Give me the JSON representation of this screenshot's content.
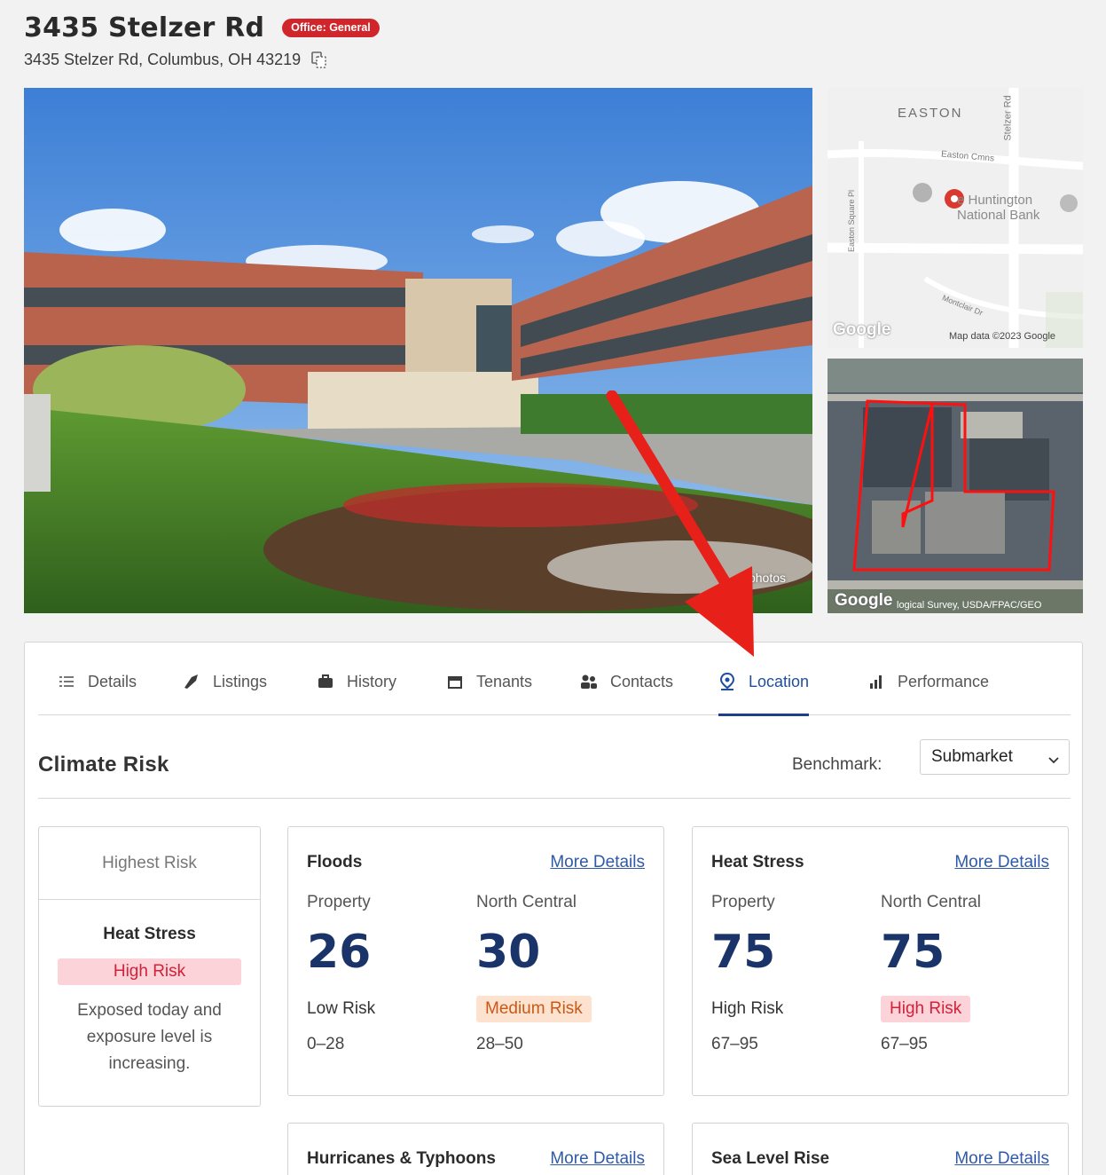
{
  "header": {
    "title": "3435 Stelzer Rd",
    "badge": "Office: General",
    "address": "3435 Stelzer Rd, Columbus, OH 43219"
  },
  "media": {
    "photo_count": "6 photos",
    "map": {
      "district": "EASTON",
      "street_stelzer": "Stelzer Rd",
      "street_easton_cmns": "Easton Cmns",
      "street_easton_sq": "Easton Square Pl",
      "street_morse": "Montclair Dr",
      "poi": "Huntington National Bank",
      "poi_line1": "e Huntington",
      "poi_line2": "National Bank",
      "logo": "Google",
      "attribution": "Map data ©2023 Google"
    },
    "satellite": {
      "logo": "Google",
      "attribution": "logical Survey, USDA/FPAC/GEO"
    }
  },
  "tabs": [
    {
      "label": "Details",
      "icon": "list-icon",
      "active": false
    },
    {
      "label": "Listings",
      "icon": "tag-icon",
      "active": false
    },
    {
      "label": "History",
      "icon": "briefcase-icon",
      "active": false
    },
    {
      "label": "Tenants",
      "icon": "storefront-icon",
      "active": false
    },
    {
      "label": "Contacts",
      "icon": "people-icon",
      "active": false
    },
    {
      "label": "Location",
      "icon": "map-pin-icon",
      "active": true
    },
    {
      "label": "Performance",
      "icon": "bar-chart-icon",
      "active": false
    }
  ],
  "climate": {
    "title": "Climate Risk",
    "benchmark_label": "Benchmark:",
    "benchmark_value": "Submarket",
    "summary": {
      "head": "Highest Risk",
      "name": "Heat Stress",
      "level": "High Risk",
      "description": "Exposed today and exposure level is increasing."
    },
    "more_details": "More Details",
    "cards": {
      "floods": {
        "title": "Floods",
        "property_label": "Property",
        "region_label": "North Central",
        "property_score": "26",
        "region_score": "30",
        "property_level": "Low Risk",
        "region_level": "Medium Risk",
        "property_range": "0–28",
        "region_range": "28–50"
      },
      "heat": {
        "title": "Heat Stress",
        "property_label": "Property",
        "region_label": "North Central",
        "property_score": "75",
        "region_score": "75",
        "property_level": "High Risk",
        "region_level": "High Risk",
        "property_range": "67–95",
        "region_range": "67–95"
      },
      "hurricanes": {
        "title": "Hurricanes & Typhoons"
      },
      "sea_level": {
        "title": "Sea Level Rise"
      }
    }
  },
  "colors": {
    "badge": "#d0262b",
    "accent": "#1f3f8c",
    "score": "#1a3469",
    "link": "#2f5aa8",
    "high_risk_bg": "#fbd3d8",
    "high_risk_text": "#d3213a",
    "medium_risk_bg": "#fde2cf",
    "medium_risk_text": "#c75a17",
    "annotation_arrow": "#e8201a"
  }
}
